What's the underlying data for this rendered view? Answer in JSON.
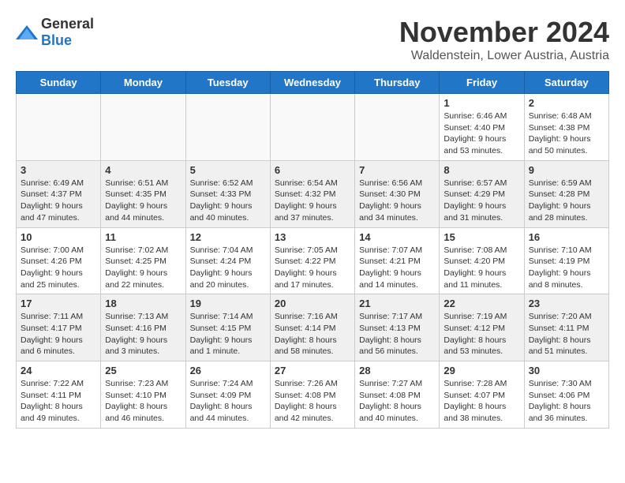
{
  "logo": {
    "general": "General",
    "blue": "Blue"
  },
  "title": "November 2024",
  "subtitle": "Waldenstein, Lower Austria, Austria",
  "headers": [
    "Sunday",
    "Monday",
    "Tuesday",
    "Wednesday",
    "Thursday",
    "Friday",
    "Saturday"
  ],
  "rows": [
    [
      {
        "day": "",
        "text": ""
      },
      {
        "day": "",
        "text": ""
      },
      {
        "day": "",
        "text": ""
      },
      {
        "day": "",
        "text": ""
      },
      {
        "day": "",
        "text": ""
      },
      {
        "day": "1",
        "text": "Sunrise: 6:46 AM\nSunset: 4:40 PM\nDaylight: 9 hours and 53 minutes."
      },
      {
        "day": "2",
        "text": "Sunrise: 6:48 AM\nSunset: 4:38 PM\nDaylight: 9 hours and 50 minutes."
      }
    ],
    [
      {
        "day": "3",
        "text": "Sunrise: 6:49 AM\nSunset: 4:37 PM\nDaylight: 9 hours and 47 minutes."
      },
      {
        "day": "4",
        "text": "Sunrise: 6:51 AM\nSunset: 4:35 PM\nDaylight: 9 hours and 44 minutes."
      },
      {
        "day": "5",
        "text": "Sunrise: 6:52 AM\nSunset: 4:33 PM\nDaylight: 9 hours and 40 minutes."
      },
      {
        "day": "6",
        "text": "Sunrise: 6:54 AM\nSunset: 4:32 PM\nDaylight: 9 hours and 37 minutes."
      },
      {
        "day": "7",
        "text": "Sunrise: 6:56 AM\nSunset: 4:30 PM\nDaylight: 9 hours and 34 minutes."
      },
      {
        "day": "8",
        "text": "Sunrise: 6:57 AM\nSunset: 4:29 PM\nDaylight: 9 hours and 31 minutes."
      },
      {
        "day": "9",
        "text": "Sunrise: 6:59 AM\nSunset: 4:28 PM\nDaylight: 9 hours and 28 minutes."
      }
    ],
    [
      {
        "day": "10",
        "text": "Sunrise: 7:00 AM\nSunset: 4:26 PM\nDaylight: 9 hours and 25 minutes."
      },
      {
        "day": "11",
        "text": "Sunrise: 7:02 AM\nSunset: 4:25 PM\nDaylight: 9 hours and 22 minutes."
      },
      {
        "day": "12",
        "text": "Sunrise: 7:04 AM\nSunset: 4:24 PM\nDaylight: 9 hours and 20 minutes."
      },
      {
        "day": "13",
        "text": "Sunrise: 7:05 AM\nSunset: 4:22 PM\nDaylight: 9 hours and 17 minutes."
      },
      {
        "day": "14",
        "text": "Sunrise: 7:07 AM\nSunset: 4:21 PM\nDaylight: 9 hours and 14 minutes."
      },
      {
        "day": "15",
        "text": "Sunrise: 7:08 AM\nSunset: 4:20 PM\nDaylight: 9 hours and 11 minutes."
      },
      {
        "day": "16",
        "text": "Sunrise: 7:10 AM\nSunset: 4:19 PM\nDaylight: 9 hours and 8 minutes."
      }
    ],
    [
      {
        "day": "17",
        "text": "Sunrise: 7:11 AM\nSunset: 4:17 PM\nDaylight: 9 hours and 6 minutes."
      },
      {
        "day": "18",
        "text": "Sunrise: 7:13 AM\nSunset: 4:16 PM\nDaylight: 9 hours and 3 minutes."
      },
      {
        "day": "19",
        "text": "Sunrise: 7:14 AM\nSunset: 4:15 PM\nDaylight: 9 hours and 1 minute."
      },
      {
        "day": "20",
        "text": "Sunrise: 7:16 AM\nSunset: 4:14 PM\nDaylight: 8 hours and 58 minutes."
      },
      {
        "day": "21",
        "text": "Sunrise: 7:17 AM\nSunset: 4:13 PM\nDaylight: 8 hours and 56 minutes."
      },
      {
        "day": "22",
        "text": "Sunrise: 7:19 AM\nSunset: 4:12 PM\nDaylight: 8 hours and 53 minutes."
      },
      {
        "day": "23",
        "text": "Sunrise: 7:20 AM\nSunset: 4:11 PM\nDaylight: 8 hours and 51 minutes."
      }
    ],
    [
      {
        "day": "24",
        "text": "Sunrise: 7:22 AM\nSunset: 4:11 PM\nDaylight: 8 hours and 49 minutes."
      },
      {
        "day": "25",
        "text": "Sunrise: 7:23 AM\nSunset: 4:10 PM\nDaylight: 8 hours and 46 minutes."
      },
      {
        "day": "26",
        "text": "Sunrise: 7:24 AM\nSunset: 4:09 PM\nDaylight: 8 hours and 44 minutes."
      },
      {
        "day": "27",
        "text": "Sunrise: 7:26 AM\nSunset: 4:08 PM\nDaylight: 8 hours and 42 minutes."
      },
      {
        "day": "28",
        "text": "Sunrise: 7:27 AM\nSunset: 4:08 PM\nDaylight: 8 hours and 40 minutes."
      },
      {
        "day": "29",
        "text": "Sunrise: 7:28 AM\nSunset: 4:07 PM\nDaylight: 8 hours and 38 minutes."
      },
      {
        "day": "30",
        "text": "Sunrise: 7:30 AM\nSunset: 4:06 PM\nDaylight: 8 hours and 36 minutes."
      }
    ]
  ]
}
